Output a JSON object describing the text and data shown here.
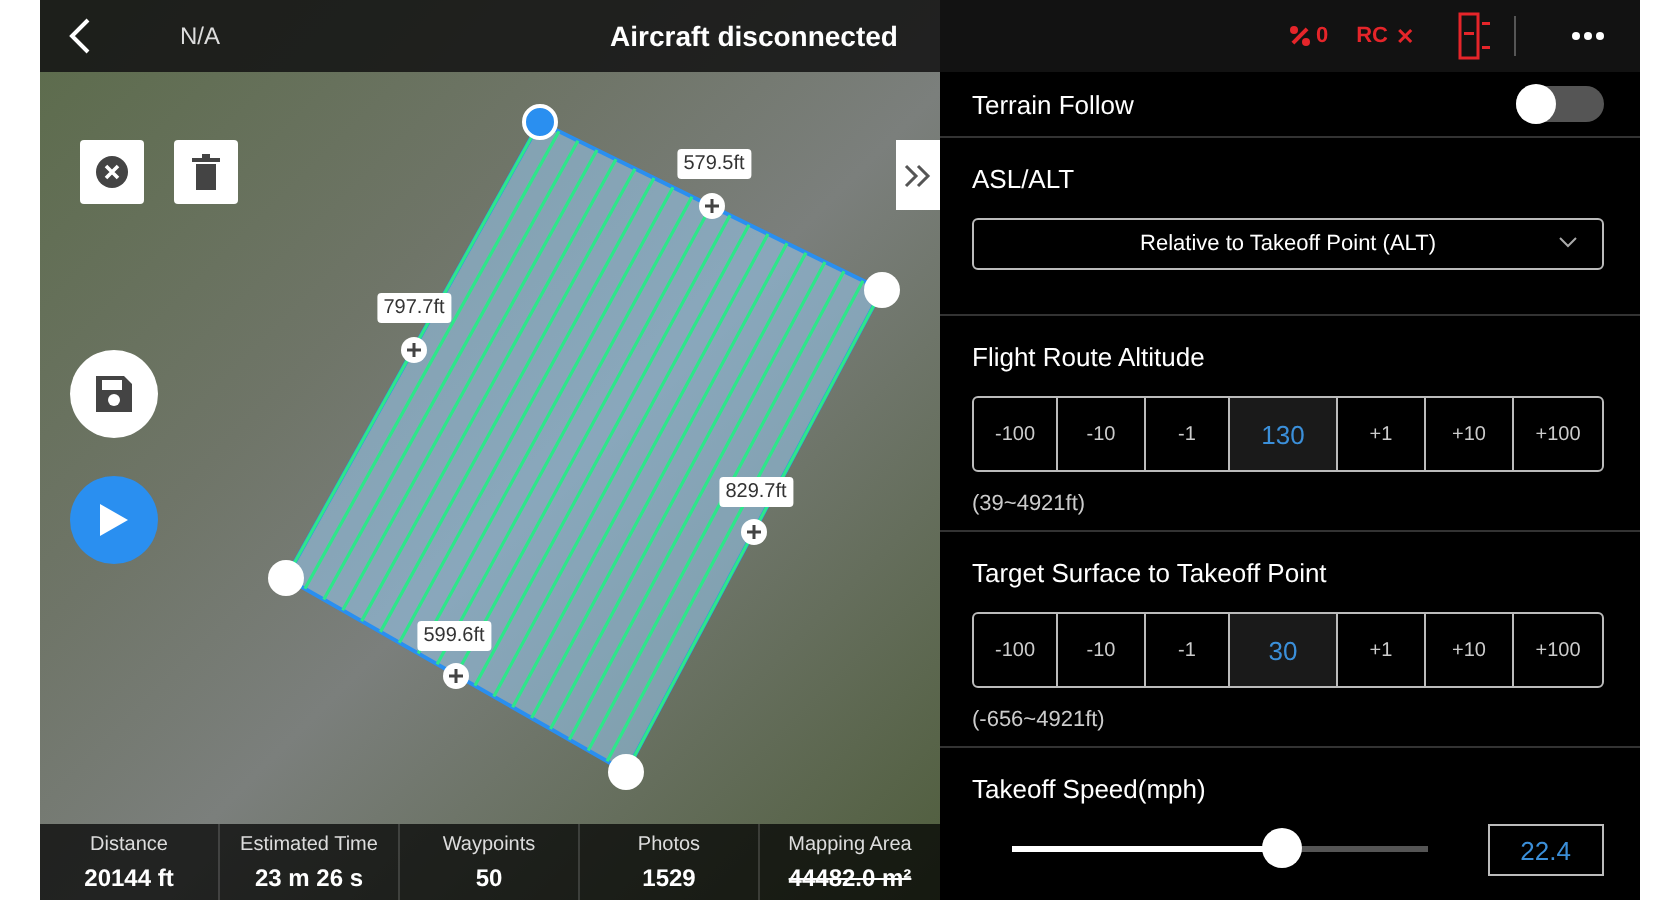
{
  "top_bar": {
    "signal_text": "N/A",
    "title": "Aircraft disconnected",
    "aircraft_count": "0",
    "rc_label": "RC",
    "rc_status": "✕"
  },
  "map": {
    "edge_lengths": [
      "579.5ft",
      "829.7ft",
      "599.6ft",
      "797.7ft"
    ],
    "stats": [
      {
        "label": "Distance",
        "value": "20144 ft",
        "struck": false
      },
      {
        "label": "Estimated Time",
        "value": "23 m 26 s",
        "struck": false
      },
      {
        "label": "Waypoints",
        "value": "50",
        "struck": false
      },
      {
        "label": "Photos",
        "value": "1529",
        "struck": false
      },
      {
        "label": "Mapping Area",
        "value": "44482.0 m²",
        "struck": true
      }
    ]
  },
  "panel": {
    "terrain_follow": {
      "label": "Terrain Follow",
      "on": false
    },
    "asl_alt": {
      "label": "ASL/ALT",
      "value": "Relative to Takeoff Point (ALT)"
    },
    "steppers": [
      {
        "label": "Flight Route Altitude",
        "range": "(39~4921ft)",
        "cells": [
          {
            "label": "-100",
            "kind": "step"
          },
          {
            "label": "-10",
            "kind": "step"
          },
          {
            "label": "-1",
            "kind": "step"
          },
          {
            "label": "130",
            "kind": "value"
          },
          {
            "label": "+1",
            "kind": "step"
          },
          {
            "label": "+10",
            "kind": "step"
          },
          {
            "label": "+100",
            "kind": "step"
          }
        ]
      },
      {
        "label": "Target Surface to Takeoff Point",
        "range": "(-656~4921ft)",
        "cells": [
          {
            "label": "-100",
            "kind": "step"
          },
          {
            "label": "-10",
            "kind": "step"
          },
          {
            "label": "-1",
            "kind": "step"
          },
          {
            "label": "30",
            "kind": "value"
          },
          {
            "label": "+1",
            "kind": "step"
          },
          {
            "label": "+10",
            "kind": "step"
          },
          {
            "label": "+100",
            "kind": "step"
          }
        ]
      }
    ],
    "takeoff_speed": {
      "label": "Takeoff Speed(mph)",
      "level": 0.65,
      "value": "22.4"
    }
  }
}
